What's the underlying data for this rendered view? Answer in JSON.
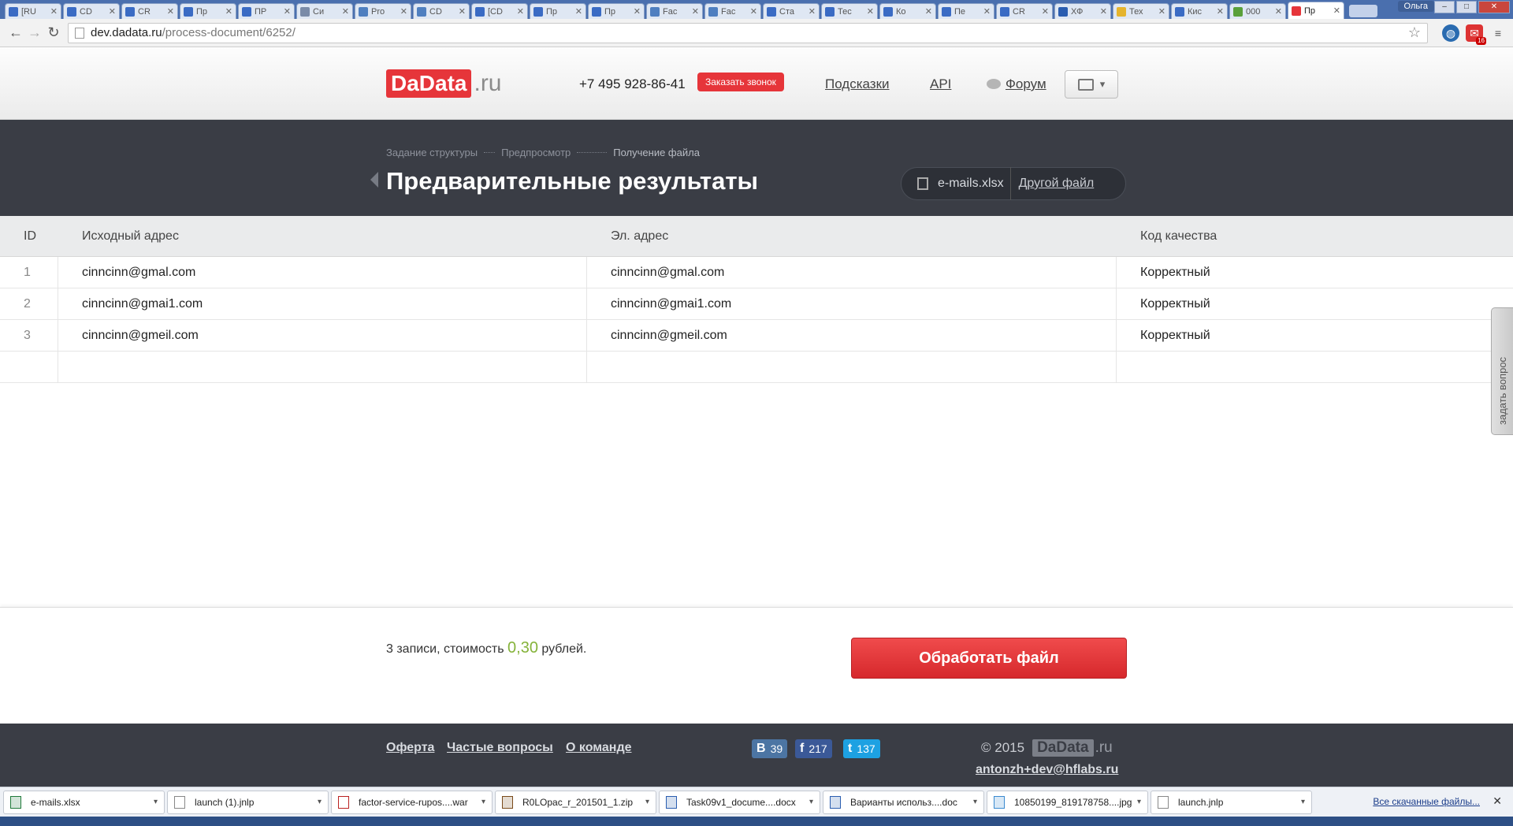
{
  "browser": {
    "tabs": [
      {
        "label": "[RU",
        "color": "#3a6bc4"
      },
      {
        "label": "CD",
        "color": "#3a6bc4"
      },
      {
        "label": "CR",
        "color": "#3a6bc4"
      },
      {
        "label": "Пр",
        "color": "#3a6bc4"
      },
      {
        "label": "ПР",
        "color": "#3a6bc4"
      },
      {
        "label": "Си",
        "color": "#7a8ba8"
      },
      {
        "label": "Pro",
        "color": "#4f7fc0"
      },
      {
        "label": "CD",
        "color": "#4f7fc0"
      },
      {
        "label": "[CD",
        "color": "#3a6bc4"
      },
      {
        "label": "Пр",
        "color": "#3a6bc4"
      },
      {
        "label": "Пр",
        "color": "#3a6bc4"
      },
      {
        "label": "Fac",
        "color": "#4f7fc0"
      },
      {
        "label": "Fac",
        "color": "#4f7fc0"
      },
      {
        "label": "Ста",
        "color": "#3a6bc4"
      },
      {
        "label": "Тес",
        "color": "#3a6bc4"
      },
      {
        "label": "Ко",
        "color": "#3a6bc4"
      },
      {
        "label": "Пе",
        "color": "#3a6bc4"
      },
      {
        "label": "CR",
        "color": "#3a6bc4"
      },
      {
        "label": "ХФ",
        "color": "#2a5db0"
      },
      {
        "label": "Тех",
        "color": "#e5b42e"
      },
      {
        "label": "Кис",
        "color": "#3a6bc4"
      },
      {
        "label": "000",
        "color": "#5aa03a"
      },
      {
        "label": "Пр",
        "color": "#e6353a",
        "active": true
      }
    ],
    "user": "Ольга",
    "url_domain": "dev.dadata.ru",
    "url_path": "/process-document/6252/",
    "gmail_count": "16"
  },
  "header": {
    "logo_main": "DaData",
    "logo_suffix": ".ru",
    "phone": "+7 495 928-86-41",
    "callback_label": "Заказать звонок",
    "nav": {
      "hints": "Подсказки",
      "api": "API",
      "forum": "Форум"
    }
  },
  "hero": {
    "steps": [
      "Задание структуры",
      "Предпросмотр",
      "Получение файла"
    ],
    "title": "Предварительные результаты",
    "file_name": "e-mails.xlsx",
    "other_file": "Другой файл"
  },
  "table": {
    "headers": {
      "id": "ID",
      "source": "Исходный адрес",
      "email": "Эл. адрес",
      "quality": "Код качества"
    },
    "rows": [
      {
        "id": "1",
        "source": "cinncinn@gmal.com",
        "email": "cinncinn@gmal.com",
        "quality": "Корректный"
      },
      {
        "id": "2",
        "source": "cinncinn@gmai1.com",
        "email": "cinncinn@gmai1.com",
        "quality": "Корректный"
      },
      {
        "id": "3",
        "source": "cinncinn@gmeil.com",
        "email": "cinncinn@gmeil.com",
        "quality": "Корректный"
      }
    ]
  },
  "side_tab": "задать вопрос",
  "summary": {
    "prefix": "3 записи, стоимость",
    "price": "0,30",
    "suffix": "рублей."
  },
  "process_button": "Обработать файл",
  "footer": {
    "links": [
      "Оферта",
      "Частые вопросы",
      "О команде"
    ],
    "social": {
      "vk": {
        "icon": "В",
        "count": "39",
        "color": "#4c75a3"
      },
      "fb": {
        "icon": "f",
        "count": "217",
        "color": "#3b5998"
      },
      "tw": {
        "icon": "t",
        "count": "137",
        "color": "#1da1e2"
      }
    },
    "copyright": "© 2015",
    "logo_main": "DaData",
    "logo_suffix": ".ru",
    "email": "antonzh+dev@hflabs.ru"
  },
  "downloads": [
    {
      "name": "e-mails.xlsx",
      "color": "#1f7a3a"
    },
    {
      "name": "launch (1).jnlp",
      "color": "#888"
    },
    {
      "name": "factor-service-rupos....war",
      "color": "#b22"
    },
    {
      "name": "R0LOpac_r_201501_1.zip",
      "color": "#7a4a1a"
    },
    {
      "name": "Task09v1_docume....docx",
      "color": "#2a5db0"
    },
    {
      "name": "Варианты использ....doc",
      "color": "#2a5db0"
    },
    {
      "name": "10850199_819178758....jpg",
      "color": "#3a8ad0"
    },
    {
      "name": "launch.jnlp",
      "color": "#888"
    }
  ],
  "downloads_all": "Все скачанные файлы..."
}
